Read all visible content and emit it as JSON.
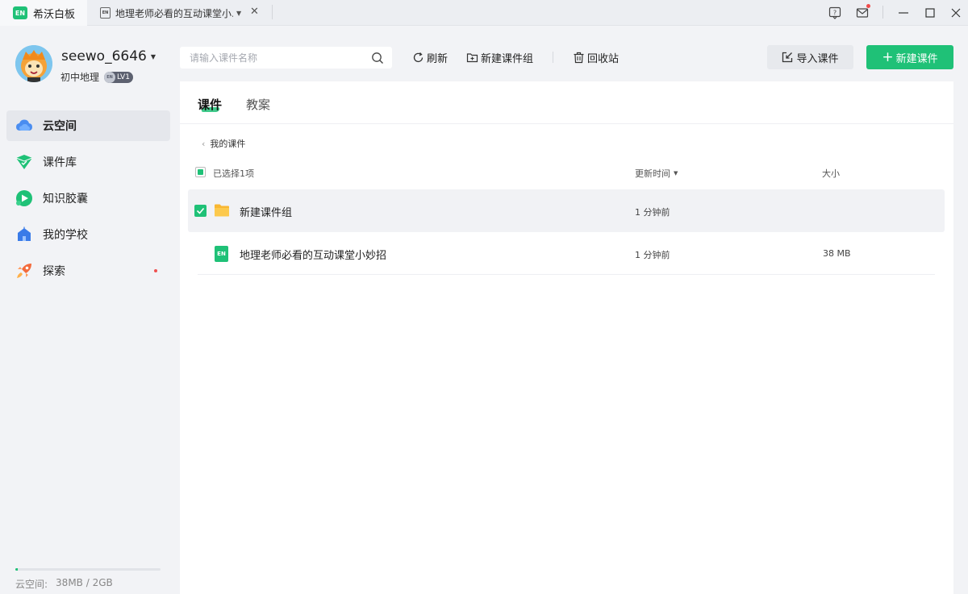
{
  "titlebar": {
    "app_name": "希沃白板",
    "app_logo_text": "EN",
    "doc_tab_icon_text": "EN",
    "doc_tab_title": "地理老师必看的互动课堂小...",
    "window_controls": [
      "help-icon",
      "mail-icon",
      "minimize-icon",
      "maximize-icon",
      "close-icon"
    ]
  },
  "user": {
    "name": "seewo_6646",
    "subject": "初中地理",
    "level_badge_text": "EN",
    "level": "LV1"
  },
  "sidebar": {
    "items": [
      {
        "label": "云空间",
        "icon": "cloud-icon",
        "active": true
      },
      {
        "label": "课件库",
        "icon": "courseware-library-icon",
        "active": false
      },
      {
        "label": "知识胶囊",
        "icon": "knowledge-capsule-icon",
        "active": false
      },
      {
        "label": "我的学校",
        "icon": "school-icon",
        "active": false
      },
      {
        "label": "探索",
        "icon": "rocket-icon",
        "active": false,
        "has_dot": true
      }
    ],
    "storage": {
      "label": "云空间:",
      "value": "38MB / 2GB",
      "fill_fraction": 0.019
    }
  },
  "toolbar": {
    "search_placeholder": "请输入课件名称",
    "refresh_label": "刷新",
    "new_group_label": "新建课件组",
    "recycle_label": "回收站",
    "import_label": "导入课件",
    "new_courseware_label": "新建课件"
  },
  "tabs": [
    {
      "label": "课件",
      "active": true
    },
    {
      "label": "教案",
      "active": false
    }
  ],
  "breadcrumb": "我的课件",
  "list": {
    "selected_text": "已选择1项",
    "col_time": "更新时间",
    "col_size": "大小",
    "rows": [
      {
        "name": "新建课件组",
        "type": "folder",
        "time": "1 分钟前",
        "size": "",
        "selected": true
      },
      {
        "name": "地理老师必看的互动课堂小妙招",
        "type": "courseware",
        "badge": "EN",
        "time": "1 分钟前",
        "size": "38 MB",
        "selected": false
      }
    ]
  },
  "colors": {
    "accent": "#1fc177",
    "background": "#f2f3f6",
    "panel": "#ffffff"
  }
}
